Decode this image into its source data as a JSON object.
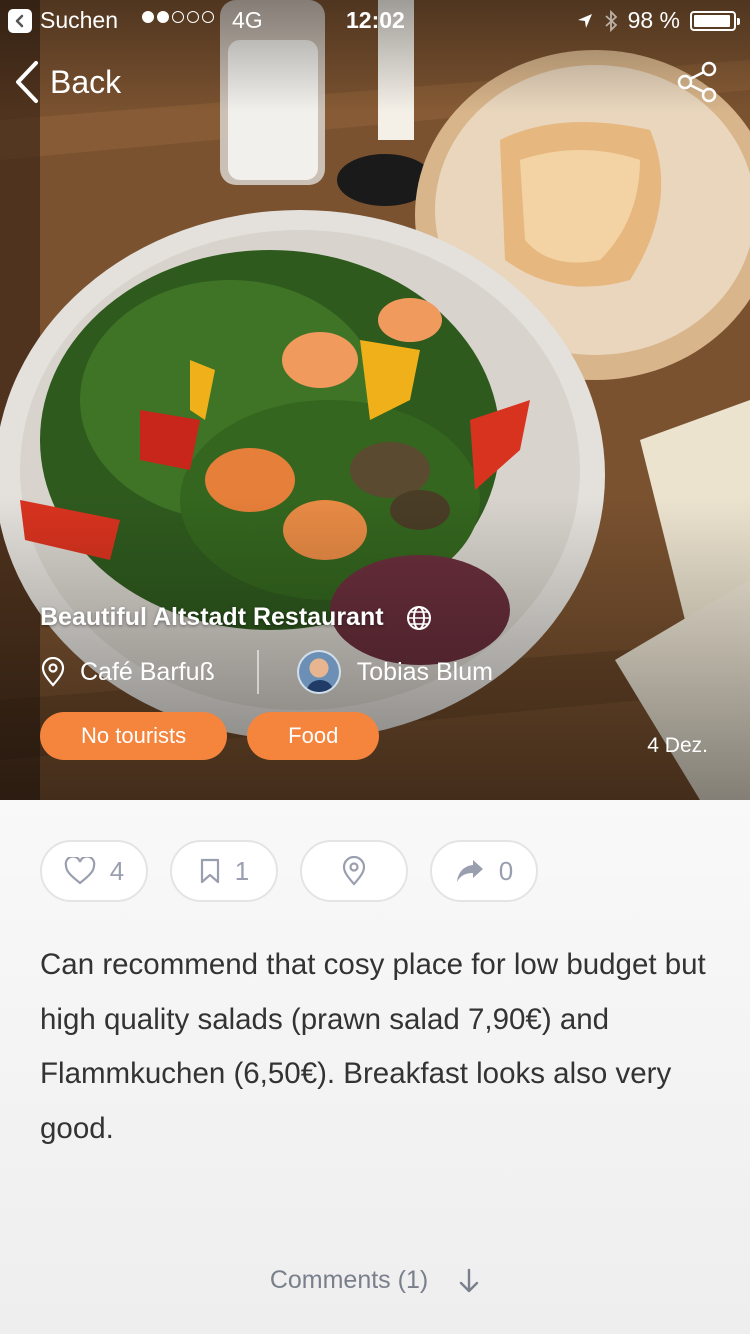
{
  "status_bar": {
    "back_app": "Suchen",
    "carrier": "4G",
    "time": "12:02",
    "battery": "98 %",
    "signal_bars": 2
  },
  "nav": {
    "back_label": "Back"
  },
  "post": {
    "title": "Beautiful Altstadt Restaurant",
    "place": "Café Barfuß",
    "author": "Tobias Blum",
    "tags": [
      "No tourists",
      "Food"
    ],
    "date": "4 Dez.",
    "description": "Can recommend that cosy place for low budget but high quality salads (prawn salad 7,90€) and Flammkuchen (6,50€). Breakfast looks also very good."
  },
  "actions": {
    "likes": "4",
    "bookmarks": "1",
    "shares": "0"
  },
  "comments": {
    "label": "Comments (1)"
  },
  "colors": {
    "accent": "#f5843d",
    "icon_gray": "#9a9fb0"
  },
  "icons": {
    "like": "heart-icon",
    "bookmark": "bookmark-icon",
    "location": "location-pin-icon",
    "share": "share-arrow-icon"
  }
}
